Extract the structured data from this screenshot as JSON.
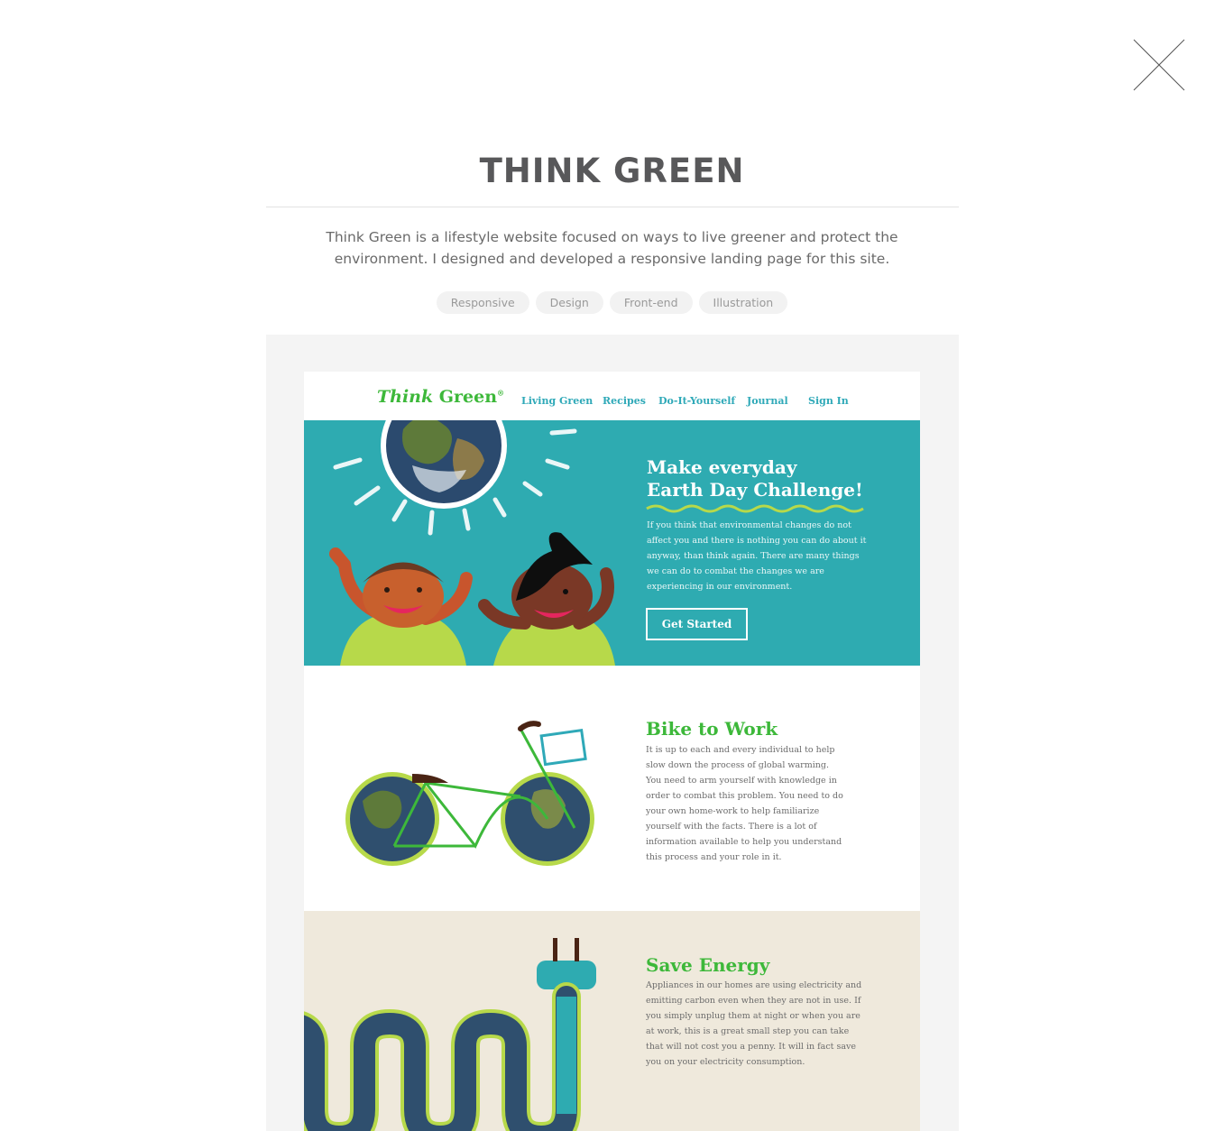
{
  "modal": {
    "close_icon": "close-icon",
    "title": "THINK GREEN",
    "description": "Think Green is a lifestyle website focused on ways to live greener and protect the environment. I designed and developed a responsive landing page for this site.",
    "tags": [
      "Responsive",
      "Design",
      "Front-end",
      "Illustration"
    ]
  },
  "site": {
    "logo_think": "Think",
    "logo_green": "Green",
    "logo_mark": "®",
    "nav": [
      "Living Green",
      "Recipes",
      "Do-It-Yourself",
      "Journal",
      "Sign In"
    ],
    "hero": {
      "title_line1": "Make everyday",
      "title_line2": "Earth Day Challenge!",
      "text": "If you think that environmental changes do not affect you and there is nothing you can do about it anyway, than think again. There are many things we can do to combat the changes we are experiencing in our environment.",
      "button": "Get Started"
    },
    "bike": {
      "title": "Bike to Work",
      "text": "It is up to each and every individual to help slow down the process of global warming. You need to arm yourself with knowledge in order to combat this problem. You need to do your own home-work to help familiarize yourself with the facts. There is a lot of information available to help you understand this process and your role in it."
    },
    "energy": {
      "title": "Save Energy",
      "text": "Appliances in our homes are using electricity and emitting carbon even when they are not in use. If you simply unplug them at night or when you are at work, this is a great small step you can take that will not cost you a penny. It will in fact save you on your electricity consumption."
    }
  },
  "colors": {
    "brand_green": "#3db83a",
    "hero_teal": "#2eabb1",
    "nav_link": "#2fa9b8",
    "paper": "#efe9dc"
  }
}
